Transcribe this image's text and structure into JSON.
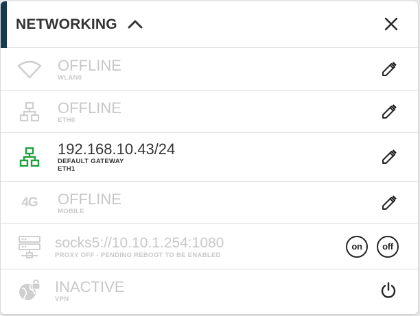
{
  "header": {
    "title": "NETWORKING",
    "collapse_icon": "chevron-up-icon",
    "close_icon": "close-icon"
  },
  "colors": {
    "accent": "#143a52",
    "active_icon": "#1e9e3e",
    "dim": "#c8c8c8",
    "text": "#333333"
  },
  "interfaces": [
    {
      "icon": "wifi-icon",
      "status": "OFFLINE",
      "label": "WLAN0",
      "state": "dim"
    },
    {
      "icon": "ethernet-icon",
      "status": "OFFLINE",
      "label": "ETH0",
      "state": "dim"
    },
    {
      "icon": "ethernet-icon",
      "status": "192.168.10.43/24",
      "label": "DEFAULT GATEWAY",
      "label2": "ETH1",
      "state": "active"
    },
    {
      "icon": "4g-icon",
      "glyph": "4G",
      "status": "OFFLINE",
      "label": "MOBILE",
      "state": "dim"
    }
  ],
  "proxy": {
    "icon": "server-icon",
    "address": "socks5://10.10.1.254:1080",
    "note": "PROXY OFF - PENDING REBOOT TO BE ENABLED",
    "on_label": "on",
    "off_label": "off"
  },
  "vpn": {
    "icon": "vpn-globe-lock-icon",
    "status": "INACTIVE",
    "label": "VPN",
    "power_icon": "power-icon"
  }
}
